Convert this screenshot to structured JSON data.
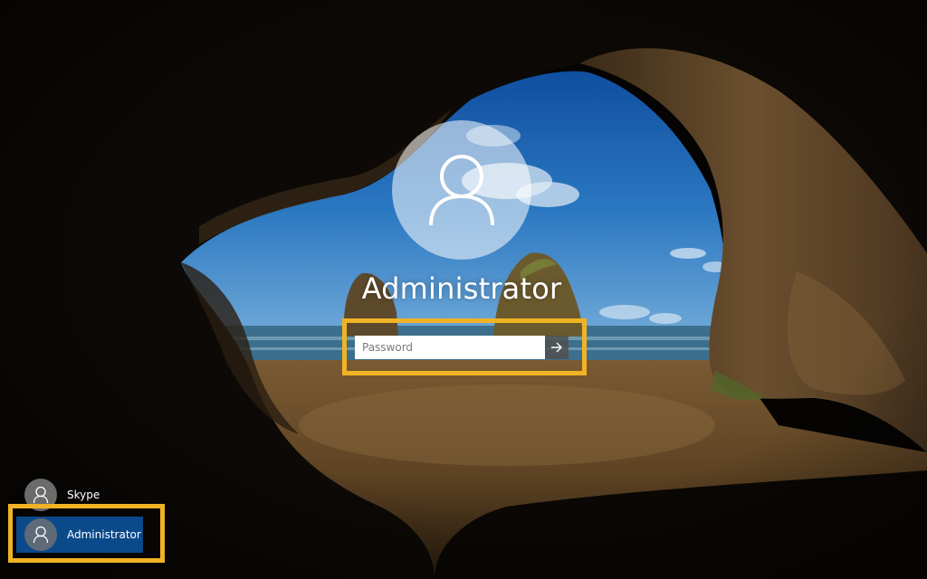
{
  "login": {
    "username": "Administrator",
    "avatar_icon": "user-icon",
    "password": {
      "value": "",
      "placeholder": "Password"
    },
    "submit_icon": "arrow-right-icon"
  },
  "users": [
    {
      "name": "Skype",
      "icon": "user-icon",
      "selected": false
    },
    {
      "name": "Administrator",
      "icon": "user-icon",
      "selected": true
    }
  ],
  "colors": {
    "highlight": "#f0b323",
    "selected_user_bg": "#0b4a8a",
    "avatar_bg": "#6b6b6b"
  }
}
